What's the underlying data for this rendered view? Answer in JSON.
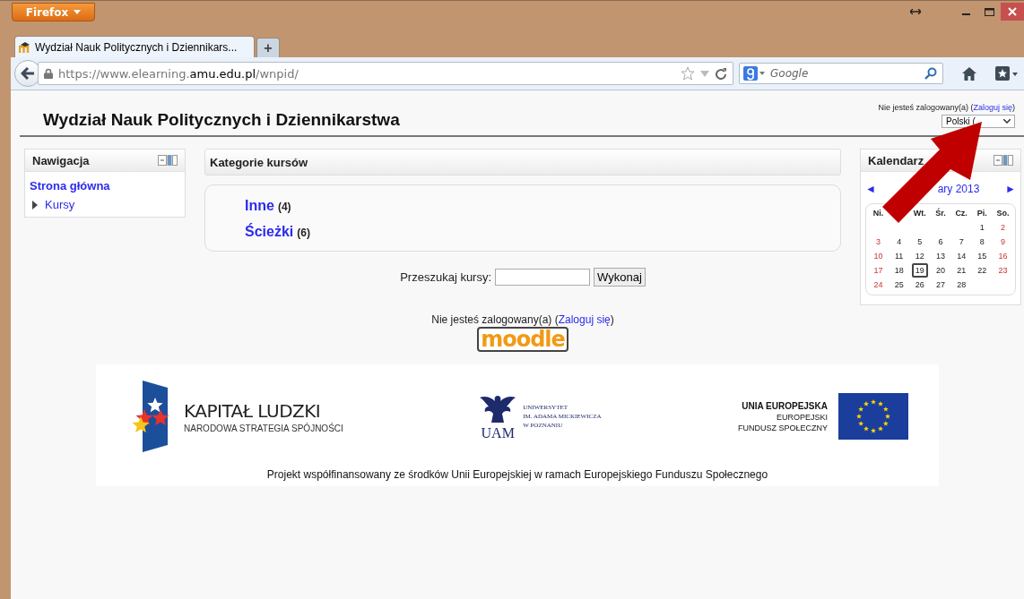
{
  "browser": {
    "menu_button": "Firefox",
    "tabs": [
      {
        "title": "Wydział Nauk Politycznych i Dziennikars...",
        "selected": true
      }
    ],
    "new_tab": "+",
    "url": {
      "prefix": "https://www.elearning.",
      "host": "amu.edu.pl",
      "path": "/wnpid/"
    },
    "search": {
      "placeholder": "Google"
    }
  },
  "page": {
    "title": "Wydział Nauk Politycznych i Dziennikarstwa",
    "login_notice": {
      "prefix": "Nie jesteś zalogowany(a) (",
      "link": "Zaloguj się",
      "suffix": ")"
    },
    "language_select": {
      "value": "Polski ("
    },
    "navigation": {
      "title": "Nawigacja",
      "items": [
        {
          "label": "Strona główna",
          "kind": "link"
        },
        {
          "label": "Kursy",
          "kind": "branch",
          "expanded": false
        }
      ]
    },
    "categories": {
      "title": "Kategorie kursów",
      "items": [
        {
          "name": "Inne",
          "count": "(4)"
        },
        {
          "name": "Ścieżki",
          "count": "(6)"
        }
      ]
    },
    "course_search": {
      "label": "Przeszukaj kursy:",
      "button": "Wykonaj"
    },
    "footer_notice": {
      "prefix": "Nie jesteś zalogowany(a) (",
      "link": "Zaloguj się",
      "suffix": ")"
    },
    "moodle_logo": "moodle",
    "calendar": {
      "title": "Kalendarz",
      "prev": "◄",
      "month": "ary 2013",
      "next": "►",
      "weekdays": [
        {
          "kind": "label",
          "label": "Ni."
        },
        {
          "kind": "blank"
        },
        {
          "kind": "label",
          "label": "Wt."
        },
        {
          "kind": "label",
          "label": "Śr."
        },
        {
          "kind": "label",
          "label": "Cz."
        },
        {
          "kind": "label",
          "label": "Pi."
        },
        {
          "kind": "label",
          "label": "So."
        }
      ],
      "weeks": [
        [
          {
            "kind": "blank"
          },
          {
            "kind": "blank"
          },
          {
            "kind": "blank"
          },
          {
            "kind": "blank"
          },
          {
            "kind": "blank"
          },
          {
            "kind": "day",
            "day": "1",
            "weekend": false,
            "today": false
          },
          {
            "kind": "day",
            "day": "2",
            "weekend": true,
            "today": false
          }
        ],
        [
          {
            "kind": "day",
            "day": "3",
            "weekend": true,
            "today": false
          },
          {
            "kind": "day",
            "day": "4",
            "weekend": false,
            "today": false
          },
          {
            "kind": "day",
            "day": "5",
            "weekend": false,
            "today": false
          },
          {
            "kind": "day",
            "day": "6",
            "weekend": false,
            "today": false
          },
          {
            "kind": "day",
            "day": "7",
            "weekend": false,
            "today": false
          },
          {
            "kind": "day",
            "day": "8",
            "weekend": false,
            "today": false
          },
          {
            "kind": "day",
            "day": "9",
            "weekend": true,
            "today": false
          }
        ],
        [
          {
            "kind": "day",
            "day": "10",
            "weekend": true,
            "today": false
          },
          {
            "kind": "day",
            "day": "11",
            "weekend": false,
            "today": false
          },
          {
            "kind": "day",
            "day": "12",
            "weekend": false,
            "today": false
          },
          {
            "kind": "day",
            "day": "13",
            "weekend": false,
            "today": false
          },
          {
            "kind": "day",
            "day": "14",
            "weekend": false,
            "today": false
          },
          {
            "kind": "day",
            "day": "15",
            "weekend": false,
            "today": false
          },
          {
            "kind": "day",
            "day": "16",
            "weekend": true,
            "today": false
          }
        ],
        [
          {
            "kind": "day",
            "day": "17",
            "weekend": true,
            "today": false
          },
          {
            "kind": "day",
            "day": "18",
            "weekend": false,
            "today": false
          },
          {
            "kind": "day",
            "day": "19",
            "weekend": false,
            "today": true
          },
          {
            "kind": "day",
            "day": "20",
            "weekend": false,
            "today": false
          },
          {
            "kind": "day",
            "day": "21",
            "weekend": false,
            "today": false
          },
          {
            "kind": "day",
            "day": "22",
            "weekend": false,
            "today": false
          },
          {
            "kind": "day",
            "day": "23",
            "weekend": true,
            "today": false
          }
        ],
        [
          {
            "kind": "day",
            "day": "24",
            "weekend": true,
            "today": false
          },
          {
            "kind": "day",
            "day": "25",
            "weekend": false,
            "today": false
          },
          {
            "kind": "day",
            "day": "26",
            "weekend": false,
            "today": false
          },
          {
            "kind": "day",
            "day": "27",
            "weekend": false,
            "today": false
          },
          {
            "kind": "day",
            "day": "28",
            "weekend": false,
            "today": false
          },
          {
            "kind": "blank"
          },
          {
            "kind": "blank"
          }
        ]
      ]
    },
    "sponsors": {
      "kapital": {
        "title": "KAPITAŁ LUDZKI",
        "subtitle": "NARODOWA STRATEGIA SPÓJNOŚCI"
      },
      "uam": {
        "mark": "UAM",
        "lines": [
          "UNIWERSYTET",
          "IM. ADAMA MICKIEWICZA",
          "W POZNANIU"
        ]
      },
      "eu": {
        "title": "UNIA EUROPEJSKA",
        "lines": [
          "EUROPEJSKI",
          "FUNDUSZ SPOŁECZNY"
        ]
      },
      "caption": "Projekt współfinansowany ze środków Unii Europejskiej w ramach Europejskiego Funduszu Społecznego"
    }
  }
}
